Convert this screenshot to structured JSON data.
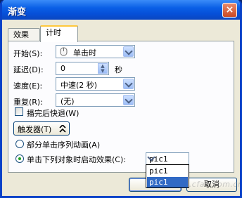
{
  "window": {
    "title": "渐变",
    "close_icon": "×"
  },
  "tabs": [
    {
      "label": "效果"
    },
    {
      "label": "计时"
    }
  ],
  "timing": {
    "start_label": "开始(S):",
    "start_value": "单击时",
    "start_icon": "mouse-icon",
    "delay_label": "延迟(D):",
    "delay_value": "0",
    "delay_unit": "秒",
    "speed_label": "速度(E):",
    "speed_value": "中速(2 秒)",
    "repeat_label": "重复(R):",
    "repeat_value": "(无)",
    "rewind_label": "播完后快退(W)",
    "rewind_checked": false,
    "trigger_label": "触发器(T)",
    "trigger_icon": "double-chevron-icon",
    "radio_sequence_label": "部分单击序列动画(A)",
    "radio_object_label": "单击下列对象时启动效果(C):",
    "object_value": "pic1",
    "dropdown_options": [
      "pic1",
      "pic1"
    ],
    "dropdown_selected_index": 1
  },
  "footer": {
    "ok_label": "确定",
    "cancel_label": "取消",
    "watermark": "www.cfan.com.cn"
  },
  "colors": {
    "titlebar": "#0a5fe6",
    "dialog_bg": "#ece9d8",
    "selection": "#316ac5",
    "active_tab_accent": "#ffc83c"
  }
}
